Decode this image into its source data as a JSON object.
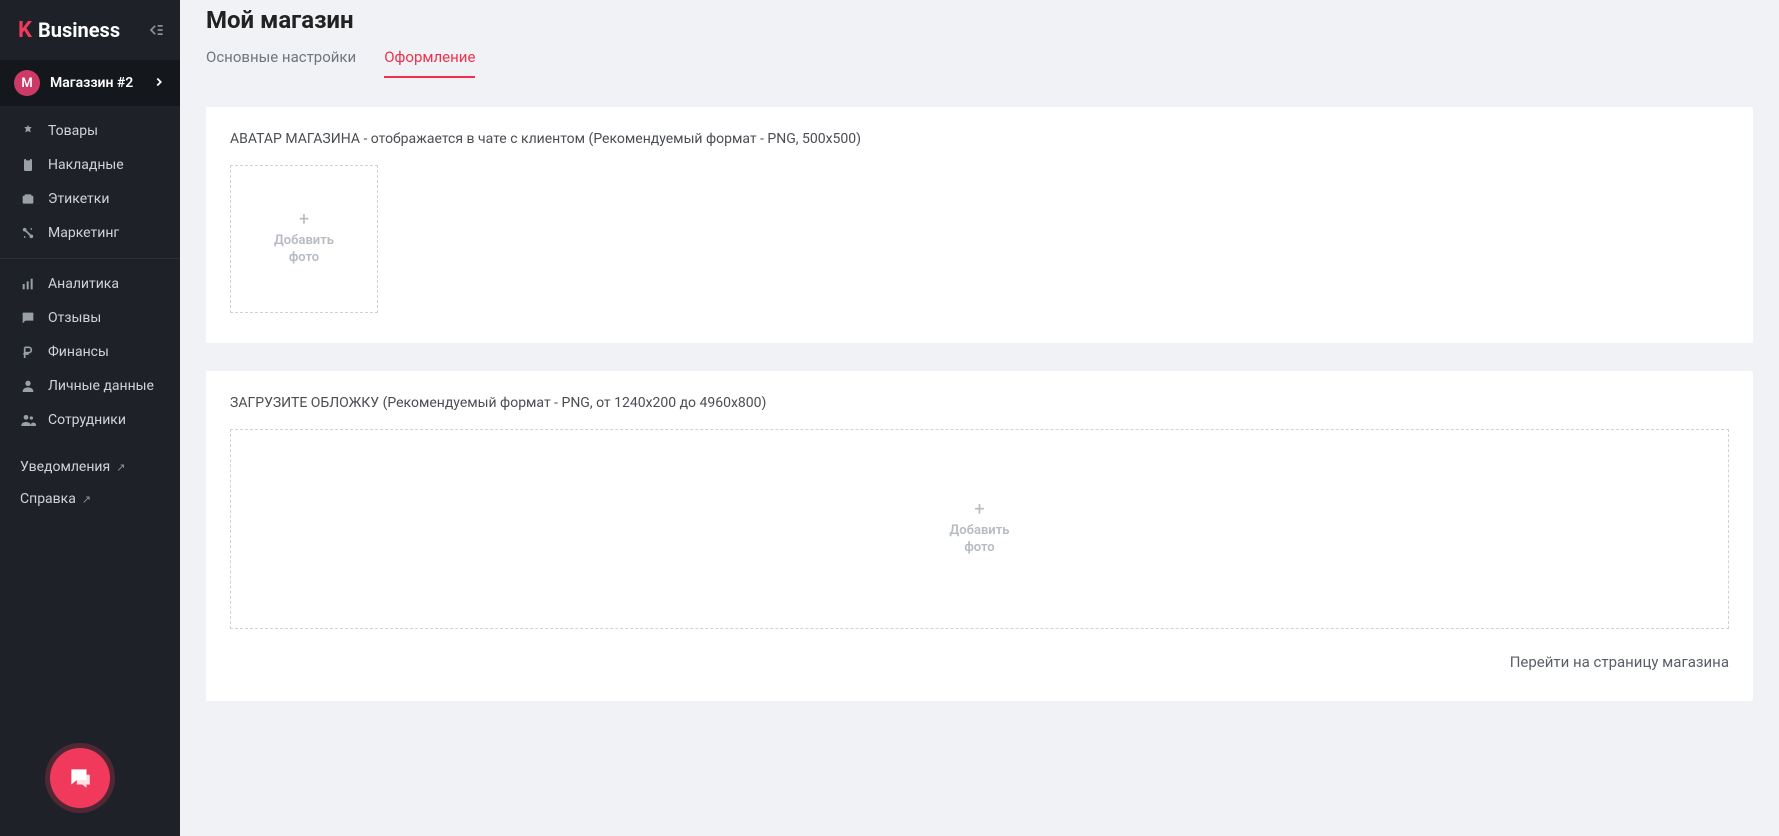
{
  "brand": {
    "k": "K",
    "name": "Business"
  },
  "store": {
    "initial": "М",
    "name": "Магаззин #2"
  },
  "nav": {
    "group1": [
      {
        "icon": "products-icon",
        "label": "Товары"
      },
      {
        "icon": "invoices-icon",
        "label": "Накладные"
      },
      {
        "icon": "labels-icon",
        "label": "Этикетки"
      },
      {
        "icon": "marketing-icon",
        "label": "Маркетинг"
      }
    ],
    "group2": [
      {
        "icon": "analytics-icon",
        "label": "Аналитика"
      },
      {
        "icon": "reviews-icon",
        "label": "Отзывы"
      },
      {
        "icon": "finance-icon",
        "label": "Финансы"
      },
      {
        "icon": "personal-icon",
        "label": "Личные данные"
      },
      {
        "icon": "employees-icon",
        "label": "Сотрудники"
      }
    ]
  },
  "links": {
    "notifications": "Уведомления",
    "help": "Справка"
  },
  "page": {
    "title": "Мой магазин",
    "tabs": [
      {
        "label": "Основные настройки",
        "active": false
      },
      {
        "label": "Оформление",
        "active": true
      }
    ]
  },
  "avatar_section": {
    "label": "АВАТАР МАГАЗИНА - отображается в чате с клиентом (Рекомендуемый формат - PNG, 500х500)",
    "add_photo": "Добавить\nфото"
  },
  "cover_section": {
    "label": "ЗАГРУЗИТЕ ОБЛОЖКУ (Рекомендуемый формат - PNG, от 1240х200 до 4960х800)",
    "add_photo": "Добавить\nфото",
    "goto_link": "Перейти на страницу магазина"
  }
}
